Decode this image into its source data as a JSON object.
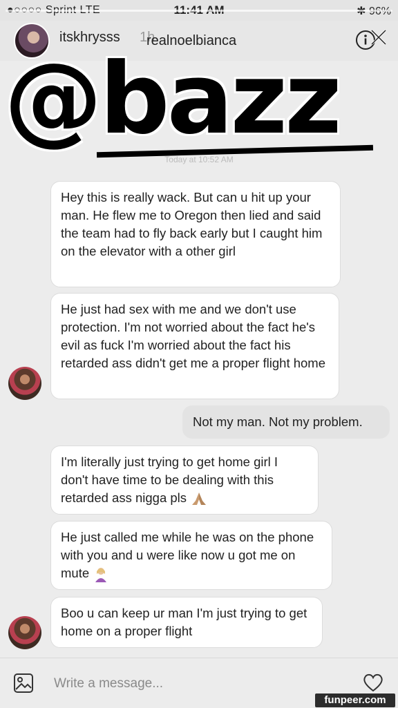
{
  "status_bar": {
    "carrier": "●○○○○ Sprint  LTE",
    "time": "11:41 AM",
    "battery": "✱ 96%"
  },
  "story": {
    "username": "itskhrysss",
    "time_ago": "1h",
    "close_icon": "close-icon"
  },
  "dm_header": {
    "title": "realnoelbianca",
    "info_icon": "info-icon"
  },
  "sticker": {
    "text": "@bazz"
  },
  "date_divider": "Today at 10:52 AM",
  "messages": [
    {
      "side": "left",
      "text": "Hey this is really wack. But can u hit up your man. He flew me to Oregon then lied and said the team had to fly back early but I caught him on the elevator with a other girl"
    },
    {
      "side": "left",
      "text": "He just had sex with me and we don't use protection. I'm not worried about the fact he's evil as fuck I'm worried about the fact his retarded ass didn't get me a proper flight home"
    },
    {
      "side": "right",
      "text": "Not my man. Not my problem."
    },
    {
      "side": "left",
      "text": "I'm literally just trying to get home girl I don't have time to be dealing with this retarded ass nigga pls",
      "emoji": "folded-hands"
    },
    {
      "side": "left",
      "text": "He just called me while he was on the phone with you and u were like now u got me on mute",
      "emoji": "woman-tipping-hand"
    },
    {
      "side": "left",
      "text": "Boo u can keep ur man I'm just trying to get home on a proper flight"
    }
  ],
  "composer": {
    "placeholder": "Write a message...",
    "gallery_icon": "gallery-icon",
    "like_icon": "heart-icon"
  },
  "watermark": "funpeer.com"
}
